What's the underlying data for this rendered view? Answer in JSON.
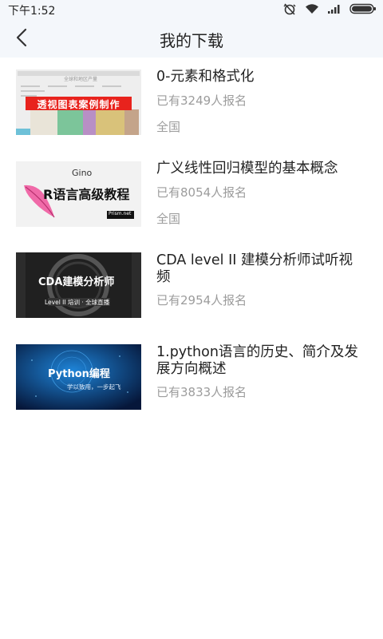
{
  "status_bar": {
    "time": "下午1:52",
    "icons": [
      "alarm-muted-icon",
      "wifi-icon",
      "signal-icon",
      "battery-icon"
    ]
  },
  "header": {
    "back_icon": "chevron-left-icon",
    "title": "我的下载"
  },
  "courses": [
    {
      "title": "0-元素和格式化",
      "enrolled": "已有3249人报名",
      "region": "全国",
      "thumb": {
        "banner": "透视图表案例制作",
        "top_text": "全球和地区产量",
        "accent": "#e8231d"
      }
    },
    {
      "title": "广义线性回归模型的基本概念",
      "enrolled": "已有8054人报名",
      "region": "全国",
      "thumb": {
        "author": "Gino",
        "heading": "R语言高级教程",
        "badge": "Prism.net"
      }
    },
    {
      "title": "CDA level II 建模分析师试听视频",
      "enrolled": "已有2954人报名",
      "thumb": {
        "heading": "CDA建模分析师",
        "sub": "Level II  培训 · 全球直播"
      }
    },
    {
      "title": "1.python语言的历史、简介及发展方向概述",
      "enrolled": "已有3833人报名",
      "thumb": {
        "heading": "Python编程",
        "sub": "学以致用，一步起飞"
      }
    }
  ],
  "colors": {
    "header_bg": "#f4f7fb",
    "meta_text": "#9c9c9c"
  }
}
